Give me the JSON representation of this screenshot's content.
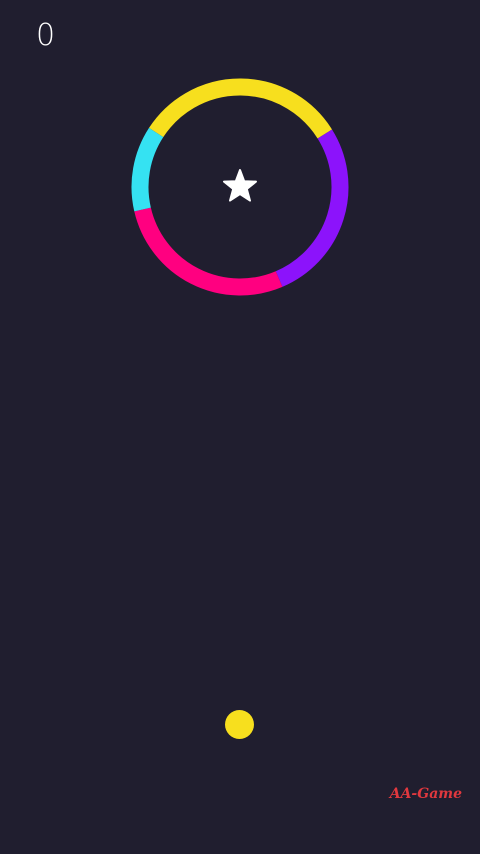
{
  "hud": {
    "score": "0"
  },
  "obstacle": {
    "type": "rotating-color-ring",
    "segments": [
      {
        "color": "yellow",
        "hex": "#f7df1e"
      },
      {
        "color": "purple",
        "hex": "#8c13fb"
      },
      {
        "color": "pink",
        "hex": "#ff0080"
      },
      {
        "color": "cyan",
        "hex": "#35e2f2"
      }
    ]
  },
  "collectible": {
    "icon": "star-icon",
    "color": "#ffffff"
  },
  "player": {
    "color_name": "yellow",
    "color": "#f7df1e"
  },
  "watermark": {
    "text": "AA-Game",
    "color": "#e0383e"
  },
  "theme": {
    "background": "#201e2f"
  }
}
